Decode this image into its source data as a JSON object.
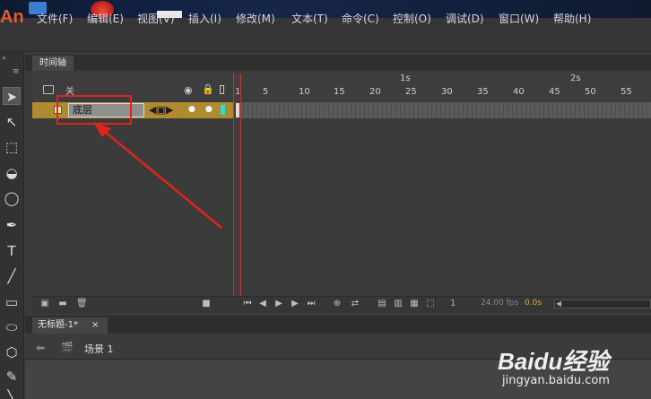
{
  "app": {
    "logo": "An",
    "logo_color": "#e35d2c"
  },
  "menubar": {
    "items": [
      "文件(F)",
      "编辑(E)",
      "视图(V)",
      "插入(I)",
      "修改(M)",
      "文本(T)",
      "命令(C)",
      "控制(O)",
      "调试(D)",
      "窗口(W)",
      "帮助(H)"
    ]
  },
  "timeline": {
    "tab_label": "时间轴",
    "header_close_label": "关",
    "ruler": {
      "seconds": [
        "1s",
        "2s"
      ],
      "frames": [
        "1",
        "5",
        "10",
        "15",
        "20",
        "25",
        "30",
        "35",
        "40",
        "45",
        "50",
        "55"
      ]
    },
    "layer": {
      "name": "底层",
      "row_color": "#b08a2e"
    },
    "footer": {
      "frame_current": "1",
      "fps": "24.00 fps",
      "time": "0.0s"
    }
  },
  "document": {
    "tab_label": "无标题-1*",
    "scene_label": "场景 1"
  },
  "annotation": {
    "color": "#e0241c"
  },
  "watermark": {
    "brand": "Baidu经验",
    "url": "jingyan.baidu.com"
  }
}
